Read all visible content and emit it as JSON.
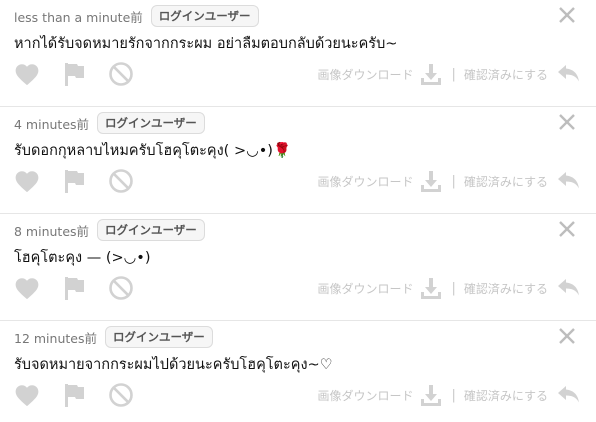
{
  "messages": [
    {
      "time": "less than a minute前",
      "badge": "ログインユーザー",
      "text": "หากได้รับจดหมายรักจากกระผม อย่าลืมตอบกลับด้วยนะครับ~",
      "download_label": "画像ダウンロード",
      "confirm_label": "確認済みにする"
    },
    {
      "time": "4 minutes前",
      "badge": "ログインユーザー",
      "text": "รับดอกกุหลาบไหมครับโฮคุโตะคุง( >◡•)🌹",
      "download_label": "画像ダウンロード",
      "confirm_label": "確認済みにする"
    },
    {
      "time": "8 minutes前",
      "badge": "ログインユーザー",
      "text": "โฮคุโตะคุง — (>◡•)",
      "download_label": "画像ダウンロード",
      "confirm_label": "確認済みにする"
    },
    {
      "time": "12 minutes前",
      "badge": "ログインユーザー",
      "text": "รับจดหมายจากกระผมไปด้วยนะครับโฮคุโตะคุง~♡",
      "download_label": "画像ダウンロード",
      "confirm_label": "確認済みにする"
    }
  ],
  "colors": {
    "icon_muted": "#d2d2d2",
    "text_muted": "#c6c6c6",
    "divider": "#e6e6e6"
  }
}
